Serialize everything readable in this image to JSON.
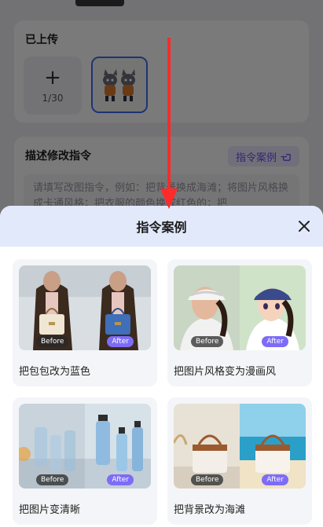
{
  "background": {
    "uploaded_title": "已上传",
    "upload_add": {
      "icon": "plus-icon",
      "plus": "+",
      "count": "1/30"
    },
    "description_title": "描述修改指令",
    "case_link_label": "指令案例",
    "case_link_icon": "pointing-hand-icon",
    "description_placeholder": "请填写改图指令，例如：把背景换成海滩；将图片风格换成卡通风格；把衣服的颜色换成红色的；把"
  },
  "sheet": {
    "title": "指令案例",
    "close_icon": "close-icon",
    "before_label": "Before",
    "after_label": "After",
    "examples": [
      {
        "caption": "把包包改为蓝色"
      },
      {
        "caption": "把图片风格变为漫画风"
      },
      {
        "caption": "把图片变清晰"
      },
      {
        "caption": "把背景改为海滩"
      }
    ]
  },
  "colors": {
    "accent": "#7d6cf6",
    "header_bg": "#e2e9fb",
    "selection": "#3b6cf5",
    "annotation": "#ff2a2a"
  }
}
